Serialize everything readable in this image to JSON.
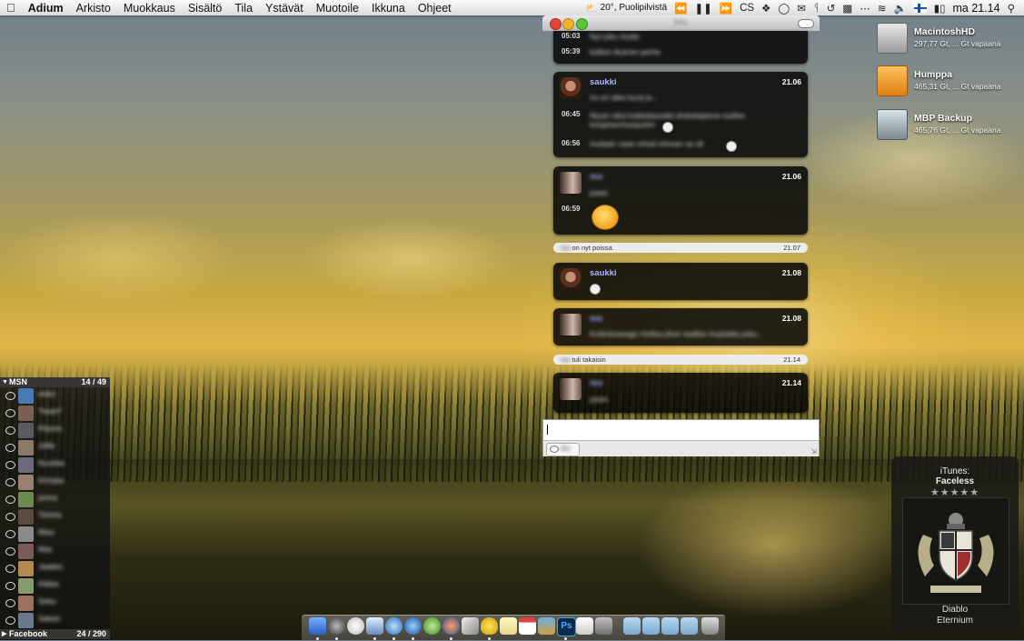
{
  "menubar": {
    "apple_icon": "apple-logo",
    "app_name": "Adium",
    "menus": [
      "Arkisto",
      "Muokkaus",
      "Sisältö",
      "Tila",
      "Ystävät",
      "Muotoile",
      "Ikkuna",
      "Ohjeet"
    ],
    "weather": "20°, Puolipilvistä",
    "clock": "ma 21.14",
    "extras_icons": [
      "weather-icon",
      "rewind-icon",
      "play-pause-icon",
      "forward-icon",
      "cs-icon",
      "dropbox-icon",
      "adium-status-icon",
      "mail-icon",
      "bluetooth-icon",
      "time-machine-icon",
      "grid-icon",
      "dots-icon",
      "wifi-icon",
      "volume-icon",
      "finnish-flag-icon",
      "battery-icon",
      "spotlight-icon"
    ]
  },
  "chat": {
    "window_title": "Mo",
    "messages": [
      {
        "sender": "",
        "time": "",
        "lines": [
          {
            "ts": "05:03",
            "text": "Nyt joku mutta"
          },
          {
            "ts": "05:39",
            "text": "kaiken ikuinen perhe"
          }
        ]
      },
      {
        "sender": "saukki",
        "time": "21.06",
        "lines": [
          {
            "ts": "",
            "text": "no on aika hyvä jo..."
          },
          {
            "ts": "06:45",
            "text": "Niyan-ollut kokkelassakii ehdottajanne tuollen lompinenmunpuhin"
          },
          {
            "ts": "06:56",
            "text": "mutiaiin vaan mindi minnan se oli"
          }
        ]
      },
      {
        "sender": "mo",
        "time": "21.06",
        "lines": [
          {
            "ts": "",
            "text": "jotain"
          },
          {
            "ts": "06:59",
            "text": ""
          }
        ]
      },
      {
        "sender": "saukki",
        "time": "21.08",
        "lines": [
          {
            "ts": "",
            "text": ""
          }
        ]
      },
      {
        "sender": "mo",
        "time": "21.08",
        "lines": [
          {
            "ts": "",
            "text": "Kotiinkaasagn hiollaa jihon taallaa mujaaldu patu..."
          }
        ]
      },
      {
        "sender": "mo",
        "time": "21.14",
        "lines": [
          {
            "ts": "",
            "text": "jotain"
          }
        ]
      }
    ],
    "status_away": {
      "name": "mo",
      "text": "on nyt poissa.",
      "time": "21.07"
    },
    "status_back": {
      "name": "mo",
      "text": "tuli takaisin",
      "time": "21.14"
    },
    "input_placeholder": "",
    "recipient_label": "Mo"
  },
  "drives": [
    {
      "name": "MacintoshHD",
      "info": "297,77 Gt, ... Gt vapaana",
      "icon": "hard-drive-icon"
    },
    {
      "name": "Humppa",
      "info": "465,31 Gt, ... Gt vapaana",
      "icon": "usb-drive-icon"
    },
    {
      "name": "MBP Backup",
      "info": "465,76 Gt, ... Gt vapaana",
      "icon": "time-machine-drive-icon"
    }
  ],
  "contacts": {
    "groups": [
      {
        "name": "MSN",
        "count": "14 / 49"
      },
      {
        "name": "Facebook",
        "count": "24 / 290"
      }
    ],
    "msn_contacts": [
      "mrko",
      "*heart*",
      "Pirjonn",
      "Joffe",
      "Nuuttas",
      "Kinnjaa",
      "jonna",
      "Timma",
      "Misu",
      "Rita",
      "Jaakko",
      "Kiikka",
      "Sebu",
      "Sakari"
    ]
  },
  "itunes": {
    "label": "iTunes:",
    "track": "Faceless",
    "stars": "★★★★★",
    "rating": 5,
    "album": "Diablo",
    "artist": "Eternium"
  },
  "dock": {
    "apps": [
      "finder-icon",
      "dashboard-icon",
      "ichat-icon",
      "preview-icon",
      "safari-icon",
      "itunes-icon",
      "utorrent-icon",
      "firefox-icon",
      "pen-icon",
      "adium-duck-icon",
      "notes-icon",
      "ical-icon",
      "iphoto-icon",
      "photoshop-icon",
      "paper-icon",
      "illustrator-icon",
      "folder-icon",
      "folder-icon-2",
      "folder-icon-3",
      "folder-icon-4",
      "trash-icon"
    ]
  },
  "colors": {
    "accent": "#aab4ff",
    "close": "#e0443c",
    "minimize": "#f0b32b",
    "zoom": "#5cc43a"
  }
}
